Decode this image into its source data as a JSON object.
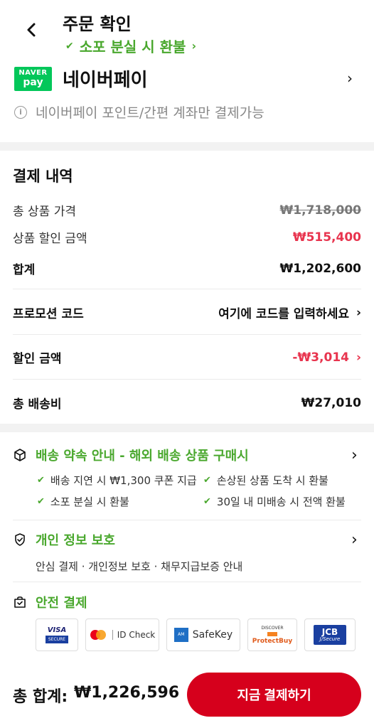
{
  "header": {
    "title": "주문 확인",
    "subtitle": "소포 분실 시 환불"
  },
  "payment_method": {
    "logo_top": "NAVER",
    "logo_bottom": "pay",
    "name": "네이버페이",
    "note": "네이버페이 포인트/간편 계좌만 결제가능"
  },
  "summary": {
    "title": "결제 내역",
    "total_price_label": "총 상품 가격",
    "total_price_value": "₩1,718,000",
    "discount_label": "상품 할인 금액",
    "discount_value": "₩515,400",
    "subtotal_label": "합계",
    "subtotal_value": "₩1,202,600",
    "promo_label": "프로모션 코드",
    "promo_placeholder": "여기에 코드를 입력하세요",
    "coupon_label": "할인 금액",
    "coupon_value": "-₩3,014",
    "shipping_label": "총 배송비",
    "shipping_value": "₩27,010"
  },
  "delivery_promise": {
    "title": "배송 약속 안내 - 해외 배송 상품 구매시",
    "items": [
      "배송 지연 시 ₩1,300 쿠폰 지급",
      "손상된 상품 도착 시 환불",
      "소포 분실 시 환불",
      "30일 내 미배송 시 전액 환불"
    ]
  },
  "privacy": {
    "title": "개인 정보 보호",
    "description": "안심 결제 · 개인정보 보호 · 채무지급보증 안내"
  },
  "secure_payment": {
    "title": "안전 결제",
    "badges": [
      {
        "top": "VISA",
        "bottom": "SECURE"
      },
      {
        "text": "ID Check"
      },
      {
        "text": "SafeKey"
      },
      {
        "top": "DISCOVER",
        "bottom": "ProtectBuy"
      },
      {
        "top": "JCB",
        "bottom": "J/Secure"
      }
    ]
  },
  "footer": {
    "total_label": "총 합계:",
    "total_value": "₩1,226,596",
    "pay_button": "지금 결제하기"
  },
  "colors": {
    "accent_green": "#4aa82e",
    "naver_green": "#03c75a",
    "sale_red": "#e8344e",
    "button_red": "#d6001c"
  }
}
